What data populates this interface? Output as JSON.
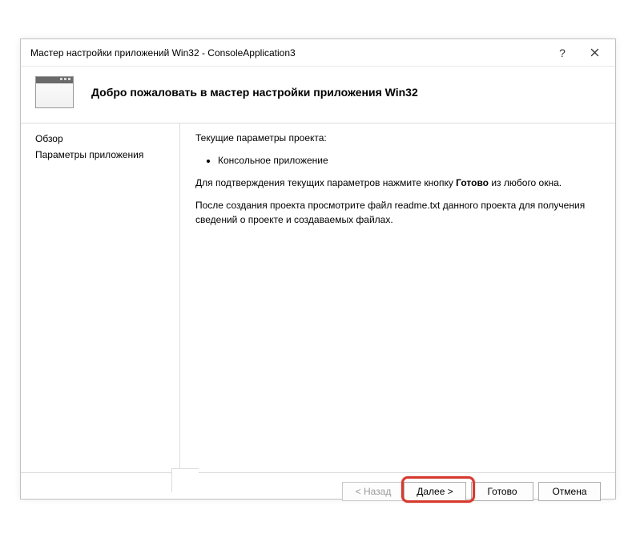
{
  "window": {
    "title": "Мастер настройки приложений Win32 - ConsoleApplication3"
  },
  "header": {
    "title": "Добро пожаловать в мастер настройки приложения Win32"
  },
  "sidebar": {
    "items": [
      {
        "label": "Обзор"
      },
      {
        "label": "Параметры приложения"
      }
    ]
  },
  "content": {
    "current_params_label": "Текущие параметры проекта:",
    "bullets": [
      "Консольное приложение"
    ],
    "confirm_prefix": "Для подтверждения текущих параметров нажмите кнопку ",
    "confirm_bold": "Готово",
    "confirm_suffix": " из любого окна.",
    "after_create": "После создания проекта просмотрите файл readme.txt данного проекта для получения сведений о проекте и создаваемых файлах."
  },
  "footer": {
    "back": "< Назад",
    "next": "Далее >",
    "finish": "Готово",
    "cancel": "Отмена"
  }
}
